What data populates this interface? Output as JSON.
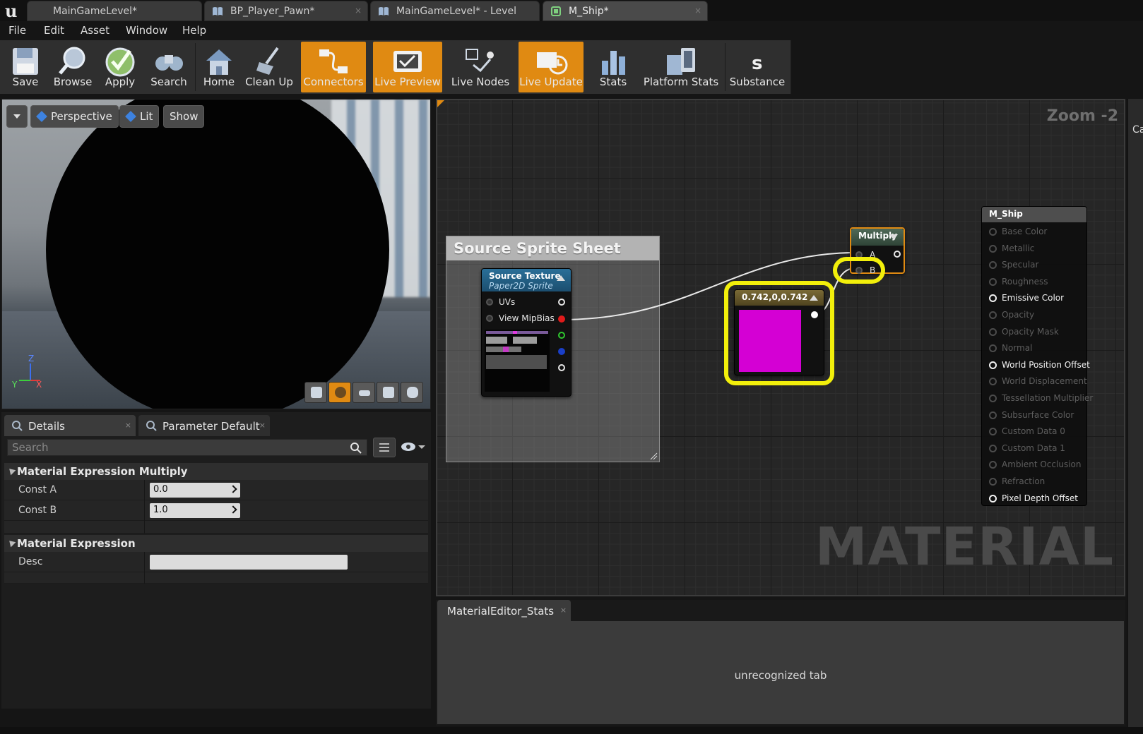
{
  "tabs": [
    {
      "label": "MainGameLevel*",
      "icon": "unreal-level-icon",
      "active": false
    },
    {
      "label": "BP_Player_Pawn*",
      "icon": "blueprint-icon",
      "active": false
    },
    {
      "label": "MainGameLevel* - Level",
      "icon": "blueprint-icon",
      "active": false
    },
    {
      "label": "M_Ship*",
      "icon": "material-icon",
      "active": true
    }
  ],
  "menu": [
    "File",
    "Edit",
    "Asset",
    "Window",
    "Help"
  ],
  "toolbar": [
    {
      "label": "Save",
      "icon": "save-icon",
      "on": false
    },
    {
      "label": "Browse",
      "icon": "browse-icon",
      "on": false
    },
    {
      "label": "Apply",
      "icon": "apply-icon",
      "on": false
    },
    {
      "label": "Search",
      "icon": "search-binoculars-icon",
      "on": false
    },
    {
      "label": "Home",
      "icon": "home-icon",
      "on": false
    },
    {
      "label": "Clean Up",
      "icon": "clean-up-icon",
      "on": false
    },
    {
      "label": "Connectors",
      "icon": "connectors-icon",
      "on": true
    },
    {
      "label": "Live Preview",
      "icon": "live-preview-icon",
      "on": true
    },
    {
      "label": "Live Nodes",
      "icon": "live-nodes-icon",
      "on": false
    },
    {
      "label": "Live Update",
      "icon": "live-update-icon",
      "on": true
    },
    {
      "label": "Stats",
      "icon": "stats-icon",
      "on": false
    },
    {
      "label": "Platform Stats",
      "icon": "platform-stats-icon",
      "on": false
    },
    {
      "label": "Substance",
      "icon": "substance-icon",
      "on": false
    }
  ],
  "viewport": {
    "perspective_label": "Perspective",
    "lit_label": "Lit",
    "show_label": "Show",
    "axis_x": "X",
    "axis_y": "Y",
    "axis_z": "Z"
  },
  "details": {
    "tab_details": "Details",
    "tab_param": "Parameter Default",
    "search_placeholder": "Search",
    "section1_title": "Material Expression Multiply",
    "const_a_label": "Const A",
    "const_a_value": "0.0",
    "const_b_label": "Const B",
    "const_b_value": "1.0",
    "section2_title": "Material Expression",
    "desc_label": "Desc",
    "desc_value": ""
  },
  "graph": {
    "zoom_label": "Zoom -2",
    "watermark": "MATERIAL",
    "comment_title": "Source Sprite Sheet",
    "texture_node": {
      "title": "Source Texture",
      "subtitle": "Paper2D Sprite",
      "pin_uvs": "UVs",
      "pin_mipbias": "View MipBias"
    },
    "multiply_node": {
      "title": "Multiply",
      "pin_a": "A",
      "pin_b": "B"
    },
    "constant_node": {
      "title": "0.742,0,0.742",
      "color": "#d400d4"
    },
    "result_node": {
      "title": "M_Ship",
      "pins": [
        {
          "label": "Base Color",
          "on": false
        },
        {
          "label": "Metallic",
          "on": false
        },
        {
          "label": "Specular",
          "on": false
        },
        {
          "label": "Roughness",
          "on": false
        },
        {
          "label": "Emissive Color",
          "on": true
        },
        {
          "label": "Opacity",
          "on": false
        },
        {
          "label": "Opacity Mask",
          "on": false
        },
        {
          "label": "Normal",
          "on": false
        },
        {
          "label": "World Position Offset",
          "on": true
        },
        {
          "label": "World Displacement",
          "on": false
        },
        {
          "label": "Tessellation Multiplier",
          "on": false
        },
        {
          "label": "Subsurface Color",
          "on": false
        },
        {
          "label": "Custom Data 0",
          "on": false
        },
        {
          "label": "Custom Data 1",
          "on": false
        },
        {
          "label": "Ambient Occlusion",
          "on": false
        },
        {
          "label": "Refraction",
          "on": false
        },
        {
          "label": "Pixel Depth Offset",
          "on": true
        }
      ]
    }
  },
  "stats": {
    "tab_label": "MaterialEditor_Stats",
    "message": "unrecognized tab"
  },
  "right_panel_letter": "Ca"
}
